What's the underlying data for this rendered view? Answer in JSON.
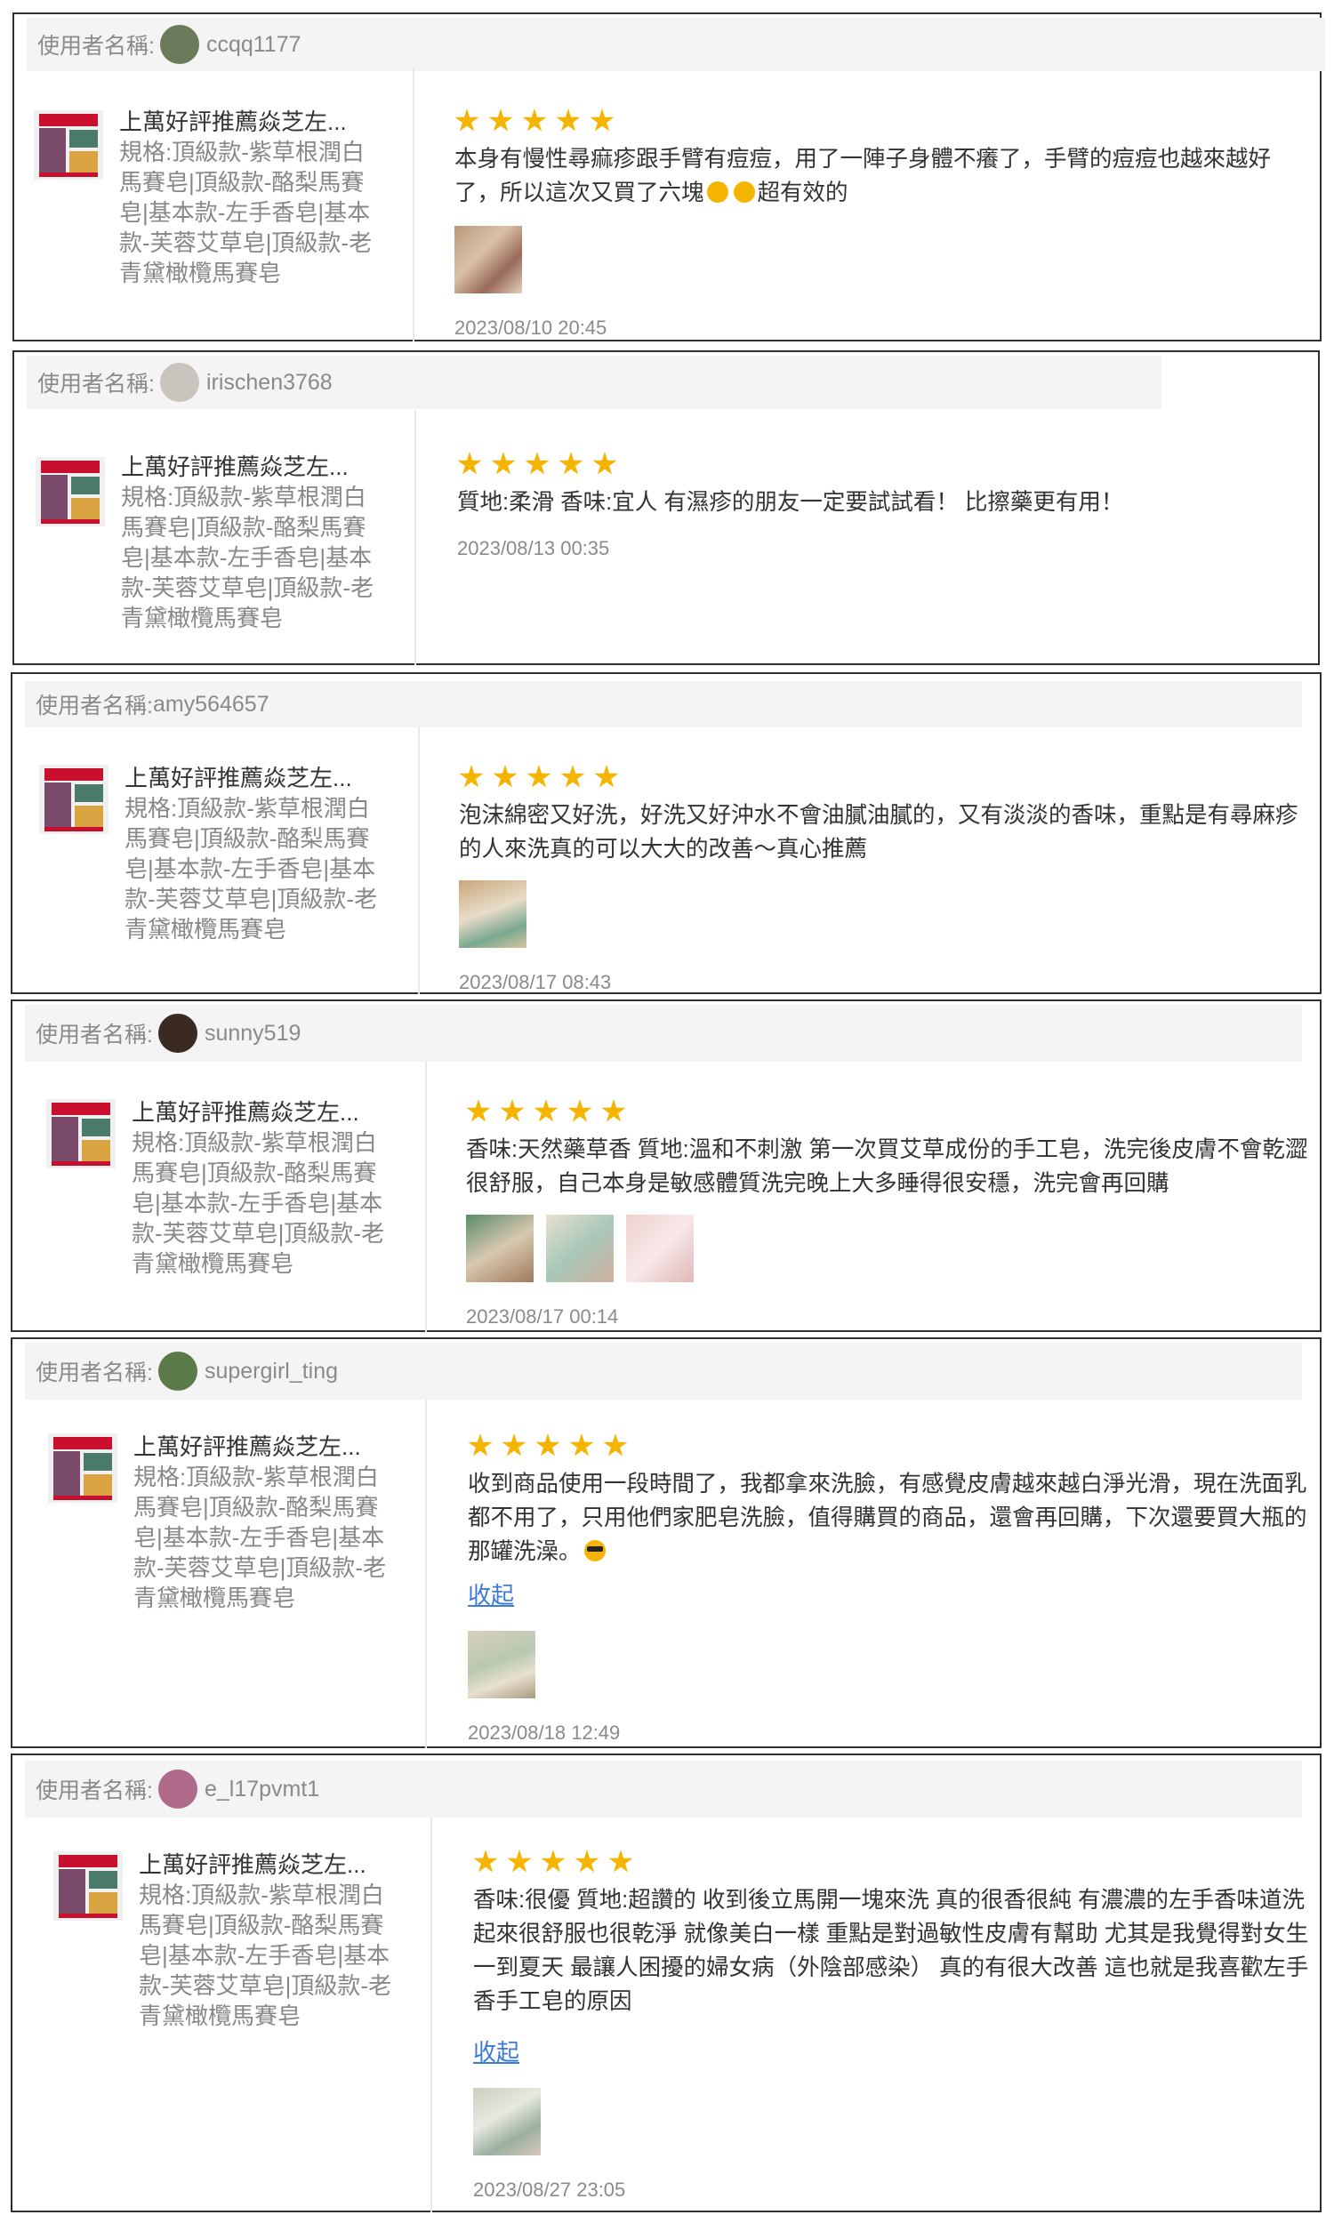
{
  "reviews": [
    {
      "user_label": "使用者名稱:",
      "username": "ccqq1177",
      "avatar_color": "#6b7a5a",
      "product_title": "上萬好評推薦焱芝左...",
      "spec": "規格:頂級款-紫草根潤白馬賽皂|頂級款-酪梨馬賽皂|基本款-左手香皂|基本款-芙蓉艾草皂|頂級款-老青黛橄欖馬賽皂",
      "rating": 5,
      "text": "本身有慢性尋痲疹跟手臂有痘痘，用了一陣子身體不癢了，手臂的痘痘也越來越好了，所以這次又買了六塊",
      "text_tail": "超有效的",
      "date": "2023/08/10 20:45"
    },
    {
      "user_label": "使用者名稱:",
      "username": "irischen3768",
      "avatar_color": "#c9c4bd",
      "product_title": "上萬好評推薦焱芝左...",
      "spec": "規格:頂級款-紫草根潤白馬賽皂|頂級款-酪梨馬賽皂|基本款-左手香皂|基本款-芙蓉艾草皂|頂級款-老青黛橄欖馬賽皂",
      "rating": 5,
      "text": "質地:柔滑 香味:宜人 有濕疹的朋友一定要試試看！ 比擦藥更有用！",
      "date": "2023/08/13 00:35"
    },
    {
      "user_label": "使用者名稱:",
      "username": "amy564657",
      "product_title": "上萬好評推薦焱芝左...",
      "spec": "規格:頂級款-紫草根潤白馬賽皂|頂級款-酪梨馬賽皂|基本款-左手香皂|基本款-芙蓉艾草皂|頂級款-老青黛橄欖馬賽皂",
      "rating": 5,
      "text": "泡沫綿密又好洗，好洗又好沖水不會油膩油膩的，又有淡淡的香味，重點是有尋麻疹的人來洗真的可以大大的改善～真心推薦",
      "date": "2023/08/17 08:43"
    },
    {
      "user_label": "使用者名稱:",
      "username": "sunny519",
      "avatar_color": "#3a2a22",
      "product_title": "上萬好評推薦焱芝左...",
      "spec": "規格:頂級款-紫草根潤白馬賽皂|頂級款-酪梨馬賽皂|基本款-左手香皂|基本款-芙蓉艾草皂|頂級款-老青黛橄欖馬賽皂",
      "rating": 5,
      "text": "香味:天然藥草香 質地:溫和不刺激 第一次買艾草成份的手工皂，洗完後皮膚不會乾澀很舒服，自己本身是敏感體質洗完晚上大多睡得很安穩，洗完會再回購",
      "date": "2023/08/17 00:14"
    },
    {
      "user_label": "使用者名稱:",
      "username": "supergirl_ting",
      "avatar_color": "#5a7a4a",
      "product_title": "上萬好評推薦焱芝左...",
      "spec": "規格:頂級款-紫草根潤白馬賽皂|頂級款-酪梨馬賽皂|基本款-左手香皂|基本款-芙蓉艾草皂|頂級款-老青黛橄欖馬賽皂",
      "rating": 5,
      "text": "收到商品使用一段時間了，我都拿來洗臉，有感覺皮膚越來越白淨光滑，現在洗面乳都不用了，只用他們家肥皂洗臉，值得購買的商品，還會再回購，下次還要買大瓶的那罐洗澡。",
      "collapse": "收起",
      "date": "2023/08/18 12:49"
    },
    {
      "user_label": "使用者名稱:",
      "username": "e_l17pvmt1",
      "avatar_color": "#b06a8a",
      "product_title": "上萬好評推薦焱芝左...",
      "spec": "規格:頂級款-紫草根潤白馬賽皂|頂級款-酪梨馬賽皂|基本款-左手香皂|基本款-芙蓉艾草皂|頂級款-老青黛橄欖馬賽皂",
      "rating": 5,
      "text": "香味:很優 質地:超讚的 收到後立馬開一塊來洗 真的很香很純 有濃濃的左手香味道洗起來很舒服也很乾淨 就像美白一樣 重點是對過敏性皮膚有幫助 尤其是我覺得對女生一到夏天 最讓人困擾的婦女病（外陰部感染） 真的有很大改善 這也就是我喜歡左手香手工皂的原因",
      "collapse": "收起",
      "date": "2023/08/27 23:05"
    }
  ]
}
